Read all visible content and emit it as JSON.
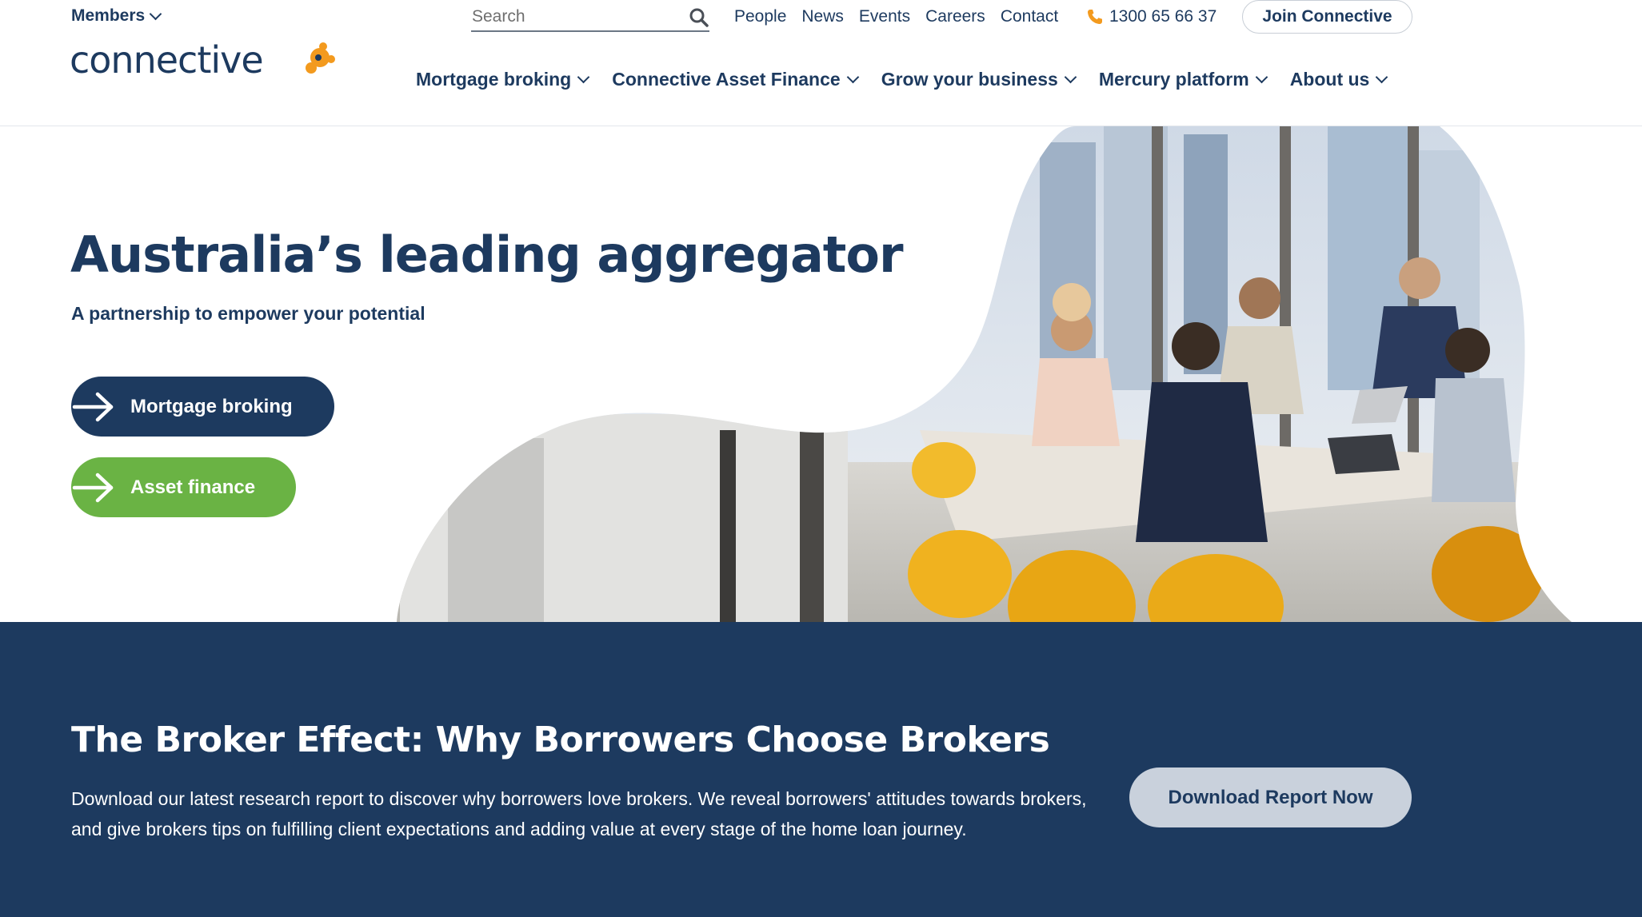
{
  "topbar": {
    "members_label": "Members",
    "search_placeholder": "Search",
    "links": [
      "People",
      "News",
      "Events",
      "Careers",
      "Contact"
    ],
    "phone": "1300 65 66 37",
    "join_label": "Join Connective"
  },
  "brand": {
    "logo_text": "connective",
    "navy": "#1d3a5f",
    "green": "#6ab344",
    "orange": "#f39a1e"
  },
  "nav": {
    "items": [
      "Mortgage broking",
      "Connective Asset Finance",
      "Grow your business",
      "Mercury platform",
      "About us"
    ]
  },
  "hero": {
    "title": "Australia’s leading aggregator",
    "subtitle": "A partnership to empower your potential",
    "buttons": [
      "Mortgage broking",
      "Asset finance"
    ]
  },
  "promo": {
    "title": "The Broker Effect: Why Borrowers Choose Brokers",
    "text": "Download our latest research report to discover why borrowers love brokers. We reveal borrowers' attitudes towards brokers, and give brokers tips on fulfilling client expectations and adding value at every stage of the home loan journey.",
    "button": "Download Report Now"
  },
  "icons": {
    "search": "search-icon",
    "phone": "phone-icon",
    "chevron": "chevron-down-icon",
    "arrow": "arrow-right-icon"
  }
}
